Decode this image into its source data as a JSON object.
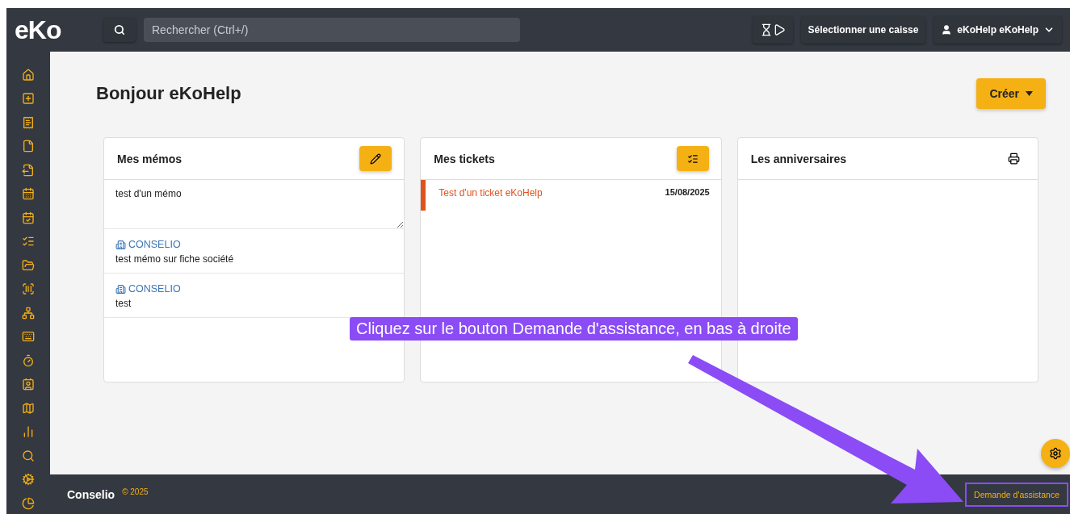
{
  "topbar": {
    "logo": "eKo",
    "search": {
      "placeholder": "Rechercher (Ctrl+/)"
    },
    "register_button": "Sélectionner une caisse",
    "user_menu": "eKoHelp eKoHelp"
  },
  "page": {
    "greeting": "Bonjour eKoHelp",
    "create_button": "Créer"
  },
  "memos": {
    "title": "Mes mémos",
    "input_value": "test d'un mémo",
    "items": [
      {
        "company": "CONSELIO",
        "text": "test mémo sur fiche société"
      },
      {
        "company": "CONSELIO",
        "text": "test"
      }
    ]
  },
  "tickets": {
    "title": "Mes tickets",
    "items": [
      {
        "title": "Test d'un ticket eKoHelp",
        "date": "15/08/2025",
        "color": "#e0521c"
      }
    ]
  },
  "birthdays": {
    "title": "Les anniversaires"
  },
  "footer": {
    "brand": "Conselio",
    "copyright": "© 2025",
    "assist_button": "Demande d'assistance"
  },
  "annotation": {
    "text": "Cliquez sur le bouton Demande d'assistance, en bas à droite"
  }
}
